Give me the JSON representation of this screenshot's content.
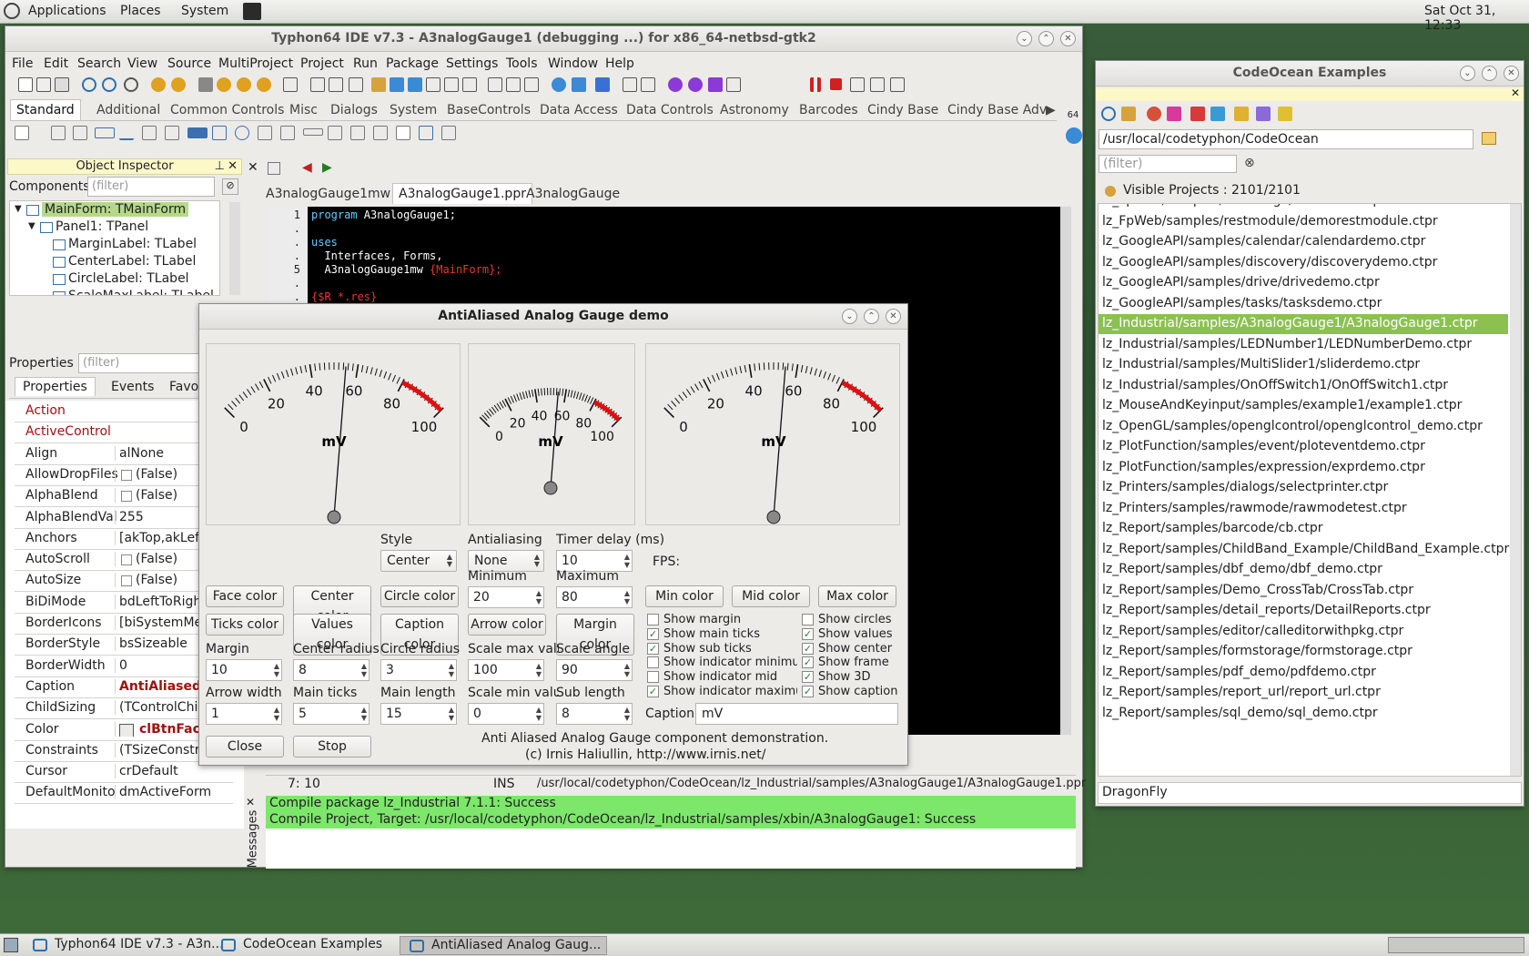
{
  "topbar": {
    "menu": [
      "Applications",
      "Places",
      "System"
    ],
    "clock": "Sat Oct 31, 12:33"
  },
  "ide": {
    "title": "Typhon64 IDE v7.3 - A3nalogGauge1 (debugging ...) for x86_64-netbsd-gtk2",
    "menu": [
      "File",
      "Edit",
      "Search",
      "View",
      "Source",
      "MultiProject",
      "Project",
      "Run",
      "Package",
      "Settings",
      "Tools",
      "Window",
      "Help"
    ],
    "palette_tabs": [
      "Standard",
      "Additional",
      "Common Controls",
      "Misc",
      "Dialogs",
      "System",
      "BaseControls",
      "Data Access",
      "Data Controls",
      "Astronomy",
      "Barcodes",
      "Cindy Base",
      "Cindy Base Adv"
    ],
    "badge": "64",
    "object_inspector": {
      "title": "Object Inspector",
      "components_label": "Components",
      "filter_placeholder": "(filter)",
      "tree": [
        "MainForm: TMainForm",
        "Panel1: TPanel",
        "MarginLabel: TLabel",
        "CenterLabel: TLabel",
        "CircleLabel: TLabel",
        "ScaleMaxLabel: TLabel"
      ],
      "properties_label": "Properties",
      "prop_tabs": [
        "Properties",
        "Events",
        "Favor"
      ],
      "props": [
        {
          "name": "Action",
          "value": ""
        },
        {
          "name": "ActiveControl",
          "value": ""
        },
        {
          "name": "Align",
          "value": "alNone"
        },
        {
          "name": "AllowDropFiles",
          "value": "(False)"
        },
        {
          "name": "AlphaBlend",
          "value": "(False)"
        },
        {
          "name": "AlphaBlendVal",
          "value": "255"
        },
        {
          "name": "Anchors",
          "value": "[akTop,akLeft]"
        },
        {
          "name": "AutoScroll",
          "value": "(False)"
        },
        {
          "name": "AutoSize",
          "value": "(False)"
        },
        {
          "name": "BiDiMode",
          "value": "bdLeftToRight"
        },
        {
          "name": "BorderIcons",
          "value": "[biSystemMenu"
        },
        {
          "name": "BorderStyle",
          "value": "bsSizeable"
        },
        {
          "name": "BorderWidth",
          "value": "0"
        },
        {
          "name": "Caption",
          "value": "AntiAliased A"
        },
        {
          "name": "ChildSizing",
          "value": "(TControlChild"
        },
        {
          "name": "Color",
          "value": "clBtnFace"
        },
        {
          "name": "Constraints",
          "value": "(TSizeConstrai"
        },
        {
          "name": "Cursor",
          "value": "crDefault"
        },
        {
          "name": "DefaultMonito",
          "value": "dmActiveForm"
        }
      ]
    },
    "editor_tabs": [
      "A3nalogGauge1mw",
      "A3nalogGauge1.ppr",
      "A3nalogGauge"
    ],
    "code_lines": [
      {
        "num": "1",
        "text": "program A3nalogGauge1;"
      },
      {
        "num": ".",
        "text": ""
      },
      {
        "num": ".",
        "text": "uses"
      },
      {
        "num": ".",
        "text": "  Interfaces, Forms,"
      },
      {
        "num": "5",
        "text": "  A3nalogGauge1mw {MainForm};"
      },
      {
        "num": ".",
        "text": ""
      },
      {
        "num": ".",
        "text": "{$R *.res}"
      }
    ],
    "status": {
      "pos": "7: 10",
      "mode": "INS",
      "path": "/usr/local/codetyphon/CodeOcean/lz_Industrial/samples/A3nalogGauge1/A3nalogGauge1.ppr"
    },
    "messages_label": "Messages",
    "messages": [
      "Compile package lz_Industrial 7.1.1: Success",
      "Compile Project, Target: /usr/local/codetyphon/CodeOcean/lz_Industrial/samples/xbin/A3nalogGauge1: Success"
    ]
  },
  "codeocean": {
    "title": "CodeOcean Examples",
    "path": "/usr/local/codetyphon/CodeOcean",
    "filter_placeholder": "(filter)",
    "visible_projects": "Visible Projects : 2101/2101",
    "items": [
      "lz_FpWeb/samples/restbridge/restserver.ctpr",
      "lz_FpWeb/samples/restmodule/demorestmodule.ctpr",
      "lz_GoogleAPI/samples/calendar/calendardemo.ctpr",
      "lz_GoogleAPI/samples/discovery/discoverydemo.ctpr",
      "lz_GoogleAPI/samples/drive/drivedemo.ctpr",
      "lz_GoogleAPI/samples/tasks/tasksdemo.ctpr",
      "lz_Industrial/samples/A3nalogGauge1/A3nalogGauge1.ctpr",
      "lz_Industrial/samples/LEDNumber1/LEDNumberDemo.ctpr",
      "lz_Industrial/samples/MultiSlider1/sliderdemo.ctpr",
      "lz_Industrial/samples/OnOffSwitch1/OnOffSwitch1.ctpr",
      "lz_MouseAndKeyinput/samples/example1/example1.ctpr",
      "lz_OpenGL/samples/openglcontrol/openglcontrol_demo.ctpr",
      "lz_PlotFunction/samples/event/ploteventdemo.ctpr",
      "lz_PlotFunction/samples/expression/exprdemo.ctpr",
      "lz_Printers/samples/dialogs/selectprinter.ctpr",
      "lz_Printers/samples/rawmode/rawmodetest.ctpr",
      "lz_Report/samples/barcode/cb.ctpr",
      "lz_Report/samples/ChildBand_Example/ChildBand_Example.ctpr",
      "lz_Report/samples/dbf_demo/dbf_demo.ctpr",
      "lz_Report/samples/Demo_CrossTab/CrossTab.ctpr",
      "lz_Report/samples/detail_reports/DetailReports.ctpr",
      "lz_Report/samples/editor/calleditorwithpkg.ctpr",
      "lz_Report/samples/formstorage/formstorage.ctpr",
      "lz_Report/samples/pdf_demo/pdfdemo.ctpr",
      "lz_Report/samples/report_url/report_url.ctpr",
      "lz_Report/samples/sql_demo/sql_demo.ctpr"
    ],
    "selected_index": 6,
    "highlight_color": "#8cc152",
    "footer": "DragonFly"
  },
  "demo": {
    "title": "AntiAliased Analog Gauge demo",
    "gauge_unit": "mV",
    "gauge_value_fraction": 0.55,
    "tick_labels": [
      "0",
      "20",
      "40",
      "60",
      "80",
      "100"
    ],
    "style_label": "Style",
    "style_value": "Center",
    "aa_label": "Antialiasing",
    "aa_value": "None",
    "timer_label": "Timer delay (ms)",
    "timer_value": "10",
    "fps_label": "FPS:",
    "min_label": "Minimum",
    "min_value": "20",
    "max_label": "Maximum",
    "max_value": "80",
    "buttons_row1": [
      "Face color",
      "Center color",
      "Circle color"
    ],
    "buttons_row2": [
      "Ticks color",
      "Values color",
      "Caption color",
      "Arrow color",
      "Margin color"
    ],
    "minmax_buttons": [
      "Min color",
      "Mid color",
      "Max color"
    ],
    "spins_row1": [
      {
        "label": "Margin",
        "value": "10"
      },
      {
        "label": "Center radius",
        "value": "8"
      },
      {
        "label": "Circle radius",
        "value": "3"
      },
      {
        "label": "Scale max value",
        "value": "100"
      },
      {
        "label": "Scale angle",
        "value": "90"
      }
    ],
    "spins_row2": [
      {
        "label": "Arrow width",
        "value": "1"
      },
      {
        "label": "Main ticks",
        "value": "5"
      },
      {
        "label": "Main length",
        "value": "15"
      },
      {
        "label": "Scale min value",
        "value": "0"
      },
      {
        "label": "Sub length",
        "value": "8"
      }
    ],
    "checks_left": [
      {
        "label": "Show margin",
        "checked": false
      },
      {
        "label": "Show main ticks",
        "checked": true
      },
      {
        "label": "Show sub ticks",
        "checked": true
      },
      {
        "label": "Show indicator minimum",
        "checked": false
      },
      {
        "label": "Show indicator mid",
        "checked": false
      },
      {
        "label": "Show indicator maximum",
        "checked": true
      }
    ],
    "checks_right": [
      {
        "label": "Show circles",
        "checked": false
      },
      {
        "label": "Show values",
        "checked": true
      },
      {
        "label": "Show center",
        "checked": true
      },
      {
        "label": "Show frame",
        "checked": true
      },
      {
        "label": "Show 3D",
        "checked": true
      },
      {
        "label": "Show caption",
        "checked": true
      }
    ],
    "caption_label": "Caption",
    "caption_value": "mV",
    "close_label": "Close",
    "stop_label": "Stop",
    "info1": "Anti Aliased Analog Gauge component demonstration.",
    "info2": "(c) Irnis Haliullin, http://www.irnis.net/"
  },
  "taskbar": [
    "Typhon64 IDE v7.3 - A3n...",
    "CodeOcean Examples",
    "AntiAliased Analog Gaug..."
  ]
}
